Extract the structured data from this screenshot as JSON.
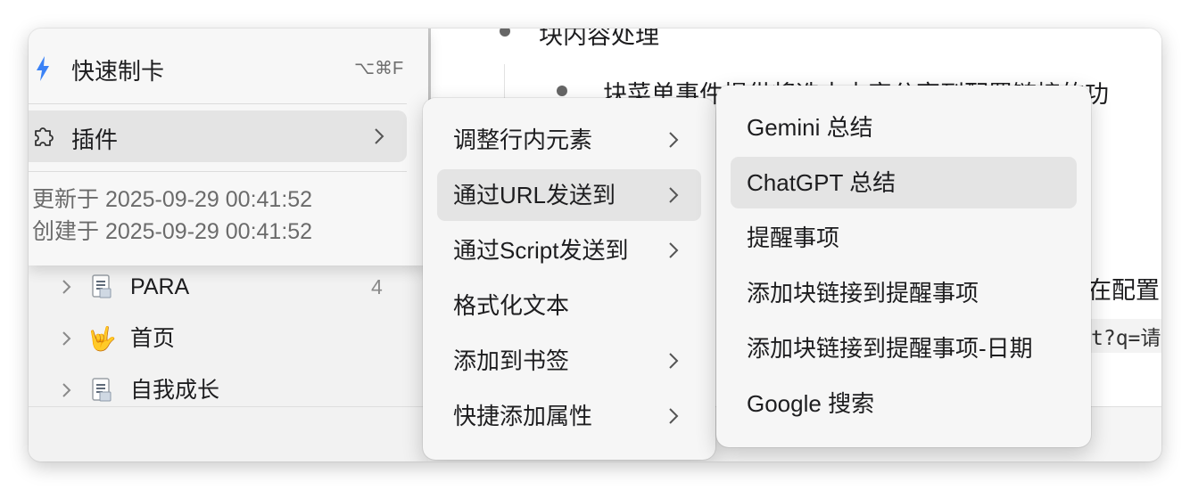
{
  "sidebar": {
    "tree": [
      {
        "label": "PARA",
        "count": "4",
        "icon": "document-icon"
      },
      {
        "label": "首页",
        "icon": "rock-hand-emoji",
        "emoji": "🤟"
      },
      {
        "label": "自我成长",
        "icon": "document-icon"
      }
    ]
  },
  "editor": {
    "lines": [
      "块内容处理",
      "块菜单事件提供将选中内容分享到配置链接的功",
      "在配置了",
      "t?q=请"
    ]
  },
  "context_menu": {
    "quick_card": {
      "label": "快速制卡",
      "shortcut": "⌥⌘F",
      "icon": "lightning-icon"
    },
    "plugins": {
      "label": "插件",
      "icon": "puzzle-icon"
    },
    "updated": "更新于 2025-09-29 00:41:52",
    "created": "创建于 2025-09-29 00:41:52"
  },
  "plugin_menu": {
    "items": [
      {
        "label": "调整行内元素",
        "has_submenu": true
      },
      {
        "label": "通过URL发送到",
        "has_submenu": true,
        "selected": true
      },
      {
        "label": "通过Script发送到",
        "has_submenu": true
      },
      {
        "label": "格式化文本",
        "has_submenu": false
      },
      {
        "label": "添加到书签",
        "has_submenu": true
      },
      {
        "label": "快捷添加属性",
        "has_submenu": true
      }
    ]
  },
  "url_menu": {
    "items": [
      {
        "label": "Gemini 总结"
      },
      {
        "label": "ChatGPT 总结",
        "selected": true
      },
      {
        "label": "提醒事项"
      },
      {
        "label": "添加块链接到提醒事项"
      },
      {
        "label": "添加块链接到提醒事项-日期"
      },
      {
        "label": "Google 搜索"
      }
    ]
  },
  "colors": {
    "accent": "#3b82f6",
    "selection": "#e4e4e4",
    "menu_bg": "#f6f6f6"
  }
}
